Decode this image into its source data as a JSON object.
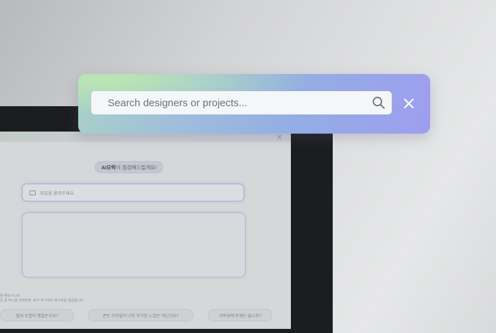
{
  "search_panel": {
    "placeholder": "Search designers or projects..."
  },
  "background_screen": {
    "ai_badge_bold": "AI오락",
    "ai_badge_rest": "이 점검해드릴게요!",
    "file_input_placeholder": "파일을 올려주세요.",
    "hint_line_1": "를 해보시나요",
    "hint_line_2": "은 중 하나를 선택하면, AI가 추가적인 피드백을 제공합니다.",
    "suggestions": [
      "컬러 조합이 괜찮은가요?",
      "폰트 스타일이 너무 무거운 느낌은 아닌가요?",
      "가독성에 문제는 없나요?"
    ]
  },
  "colors": {
    "panel_gradient_start": "#bce8b0",
    "panel_gradient_end": "#9d9ef0",
    "field_bg": "#f5f6f7",
    "icon_color": "#ffffff"
  }
}
